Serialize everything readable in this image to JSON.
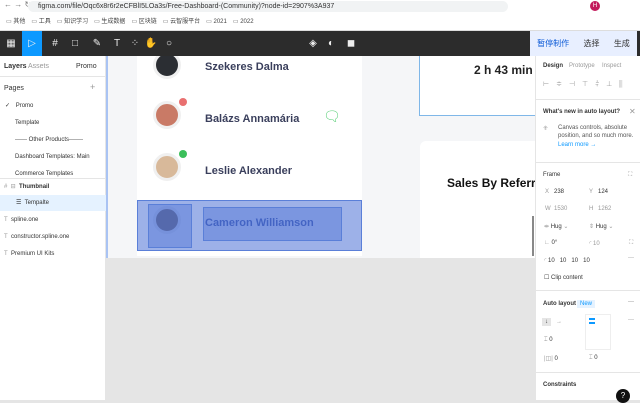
{
  "browser": {
    "url": "figma.com/file/Oqc6x8r6r2eCFBlI5LOa3s/Free-Dashboard-(Community)?node-id=2907%3A937",
    "profile": "H"
  },
  "bookmarks": [
    "其他",
    "工具",
    "知识学习",
    "生成数据",
    "区块链",
    "云智服平台",
    "2021",
    "2022"
  ],
  "toolbar": {
    "right_buttons": [
      "暂停制作",
      "选择",
      "生成"
    ],
    "accent": "#0d99ff"
  },
  "left_panel": {
    "tabs": [
      "Layers",
      "Assets"
    ],
    "page_selector": "Promo",
    "pages_label": "Pages",
    "pages": [
      "Promo",
      "Template",
      "------ Other Products-------",
      "Dashboard Templates: Main",
      "Commerce Templates"
    ],
    "layers": [
      "Thumbnail",
      "Tempalte",
      "spline.one",
      "constructor.spline.one",
      "Premium UI Kits"
    ]
  },
  "canvas": {
    "contacts": [
      {
        "name": "Szekeres Dalma"
      },
      {
        "name": "Balázs Annamária"
      },
      {
        "name": "Leslie Alexander"
      },
      {
        "name": "Cameron Williamson"
      }
    ],
    "time": "2 h 43 min",
    "sales_title": "Sales By Referr"
  },
  "right_panel": {
    "tabs": [
      "Design",
      "Prototype",
      "Inspect"
    ],
    "whats_new_title": "What's new in auto layout?",
    "whats_new_text": "Canvas controls, absolute position, and so much more.",
    "learn_more": "Learn more →",
    "frame_label": "Frame",
    "x_label": "X",
    "x": "238",
    "y_label": "Y",
    "y": "124",
    "w_label": "W",
    "w": "1530",
    "h_label": "H",
    "h": "1262",
    "hug_w": "Hug",
    "hug_h": "Hug",
    "rotation": "0°",
    "radius": "10",
    "corners": [
      "10",
      "10",
      "10",
      "10"
    ],
    "clip_content": "Clip content",
    "auto_layout": "Auto layout",
    "new_badge": "New",
    "spacing": "0",
    "padding_h": "0",
    "padding_v": "0",
    "constraints": "Constraints",
    "help": "?"
  }
}
